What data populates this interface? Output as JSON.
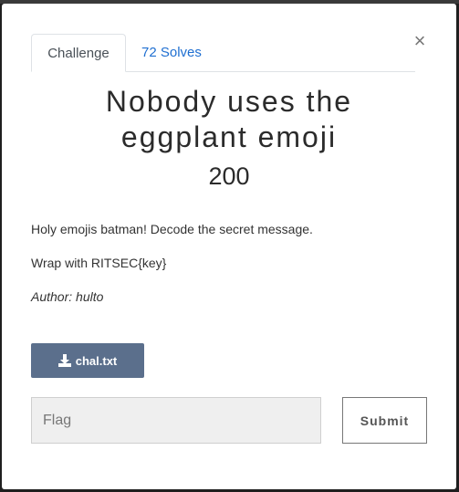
{
  "tabs": [
    {
      "label": "Challenge",
      "active": true
    },
    {
      "label": "72 Solves",
      "active": false
    }
  ],
  "close_glyph": "×",
  "challenge": {
    "title_line1": "Nobody uses the",
    "title_line2": "eggplant emoji",
    "value": "200",
    "description": [
      "Holy emojis batman! Decode the secret message.",
      "Wrap with RITSEC{key}"
    ],
    "author": "Author: hulto"
  },
  "file": {
    "label": "chal.txt",
    "icon": "download-icon"
  },
  "flag": {
    "placeholder": "Flag",
    "value": ""
  },
  "submit_label": "Submit",
  "colors": {
    "accent_link": "#1f6fd1",
    "file_button": "#5b6f8c",
    "input_bg": "#efefef"
  }
}
